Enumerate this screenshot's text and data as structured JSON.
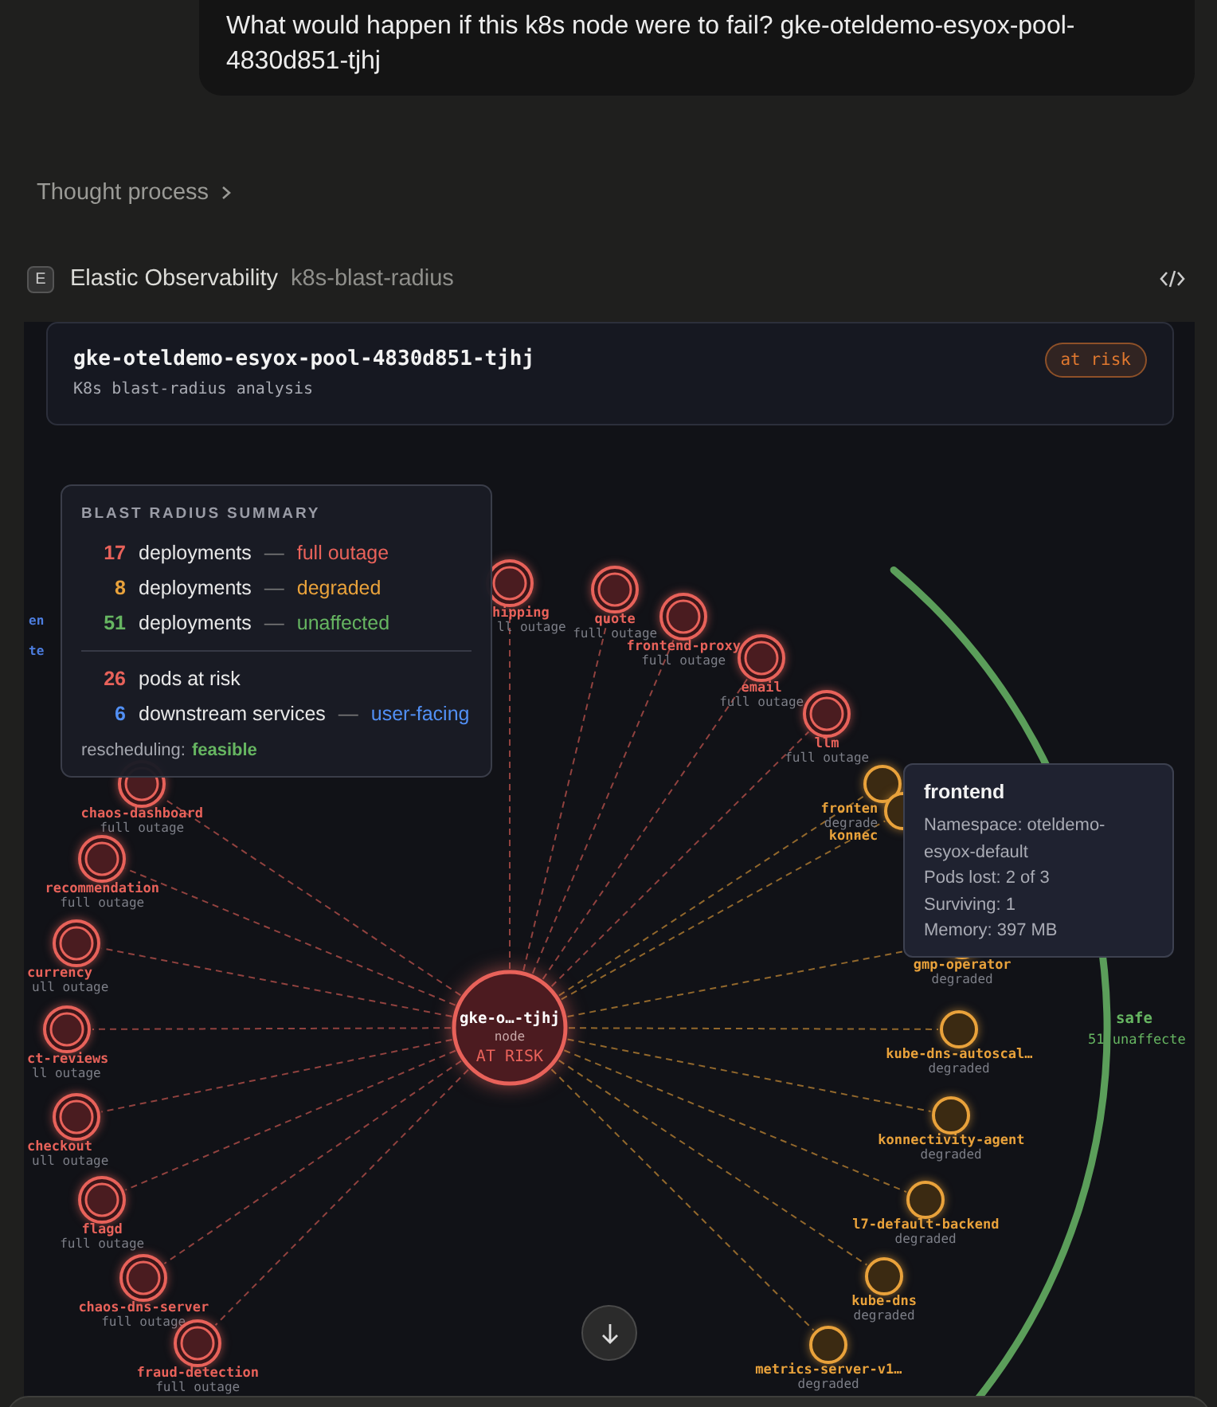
{
  "user_message": "What would happen if this k8s node were to fail? gke-oteldemo-esyox-pool-4830d851-tjhj",
  "thought_process": {
    "label": "Thought process",
    "expanded": false
  },
  "tool": {
    "badge": "E",
    "name": "Elastic Observability",
    "tool_name": "k8s-blast-radius"
  },
  "header": {
    "title": "gke-oteldemo-esyox-pool-4830d851-tjhj",
    "subtitle": "K8s blast-radius analysis",
    "status": {
      "label": "at risk",
      "kind": "warning"
    }
  },
  "summary": {
    "title": "BLAST RADIUS SUMMARY",
    "groups": [
      [
        {
          "count": "17",
          "label": "deployments",
          "dash": "—",
          "detail": "full outage",
          "kind": "outage"
        },
        {
          "count": "8",
          "label": "deployments",
          "dash": "—",
          "detail": "degraded",
          "kind": "degraded"
        },
        {
          "count": "51",
          "label": "deployments",
          "dash": "—",
          "detail": "unaffected",
          "kind": "unaffected"
        }
      ],
      [
        {
          "count": "26",
          "label": "pods at risk",
          "kind": "outage"
        },
        {
          "count": "6",
          "label": "downstream services",
          "dash": "—",
          "detail": "user-facing",
          "kind": "downstream"
        }
      ]
    ],
    "rescheduling": {
      "label": "rescheduling:",
      "value": "feasible",
      "kind": "unaffected"
    }
  },
  "graph": {
    "center": {
      "name": "gke-o…-tjhj",
      "type": "node",
      "status": "AT RISK"
    },
    "partial_labels": [
      "en",
      "te"
    ],
    "deployments": [
      {
        "name": "hipping",
        "status": "ll outage",
        "kind": "outage"
      },
      {
        "name": "quote",
        "status": "full outage",
        "kind": "outage"
      },
      {
        "name": "frontend-proxy",
        "status": "full outage",
        "kind": "outage"
      },
      {
        "name": "email",
        "status": "full outage",
        "kind": "outage"
      },
      {
        "name": "llm",
        "status": "full outage",
        "kind": "outage"
      },
      {
        "name": "chaos-dashboard",
        "status": "full outage",
        "kind": "outage"
      },
      {
        "name": "recommendation",
        "status": "full outage",
        "kind": "outage"
      },
      {
        "name": "currency",
        "status": "ull outage",
        "kind": "outage"
      },
      {
        "name": "ct-reviews",
        "status": "ll outage",
        "kind": "outage"
      },
      {
        "name": "checkout",
        "status": "ull outage",
        "kind": "outage"
      },
      {
        "name": "flagd",
        "status": "full outage",
        "kind": "outage"
      },
      {
        "name": "chaos-dns-server",
        "status": "full outage",
        "kind": "outage"
      },
      {
        "name": "fraud-detection",
        "status": "full outage",
        "kind": "outage"
      },
      {
        "name": "fronten",
        "status": "degrade",
        "kind": "degraded"
      },
      {
        "name": "konnec",
        "kind": "degraded"
      },
      {
        "name": "gmp-operator",
        "status": "degraded",
        "kind": "degraded"
      },
      {
        "name": "kube-dns-autoscal…",
        "status": "degraded",
        "kind": "degraded"
      },
      {
        "name": "konnectivity-agent",
        "status": "degraded",
        "kind": "degraded"
      },
      {
        "name": "l7-default-backend",
        "status": "degraded",
        "kind": "degraded"
      },
      {
        "name": "kube-dns",
        "status": "degraded",
        "kind": "degraded"
      },
      {
        "name": "metrics-server-v1…",
        "status": "degraded",
        "kind": "degraded"
      }
    ],
    "safe": {
      "label": "safe",
      "count": "51 unaffecte"
    }
  },
  "tooltip": {
    "title": "frontend",
    "lines": [
      "Namespace: oteldemo-esyox-default",
      "Pods lost: 2 of 3",
      "Surviving: 1",
      "Memory: 397 MB"
    ]
  }
}
